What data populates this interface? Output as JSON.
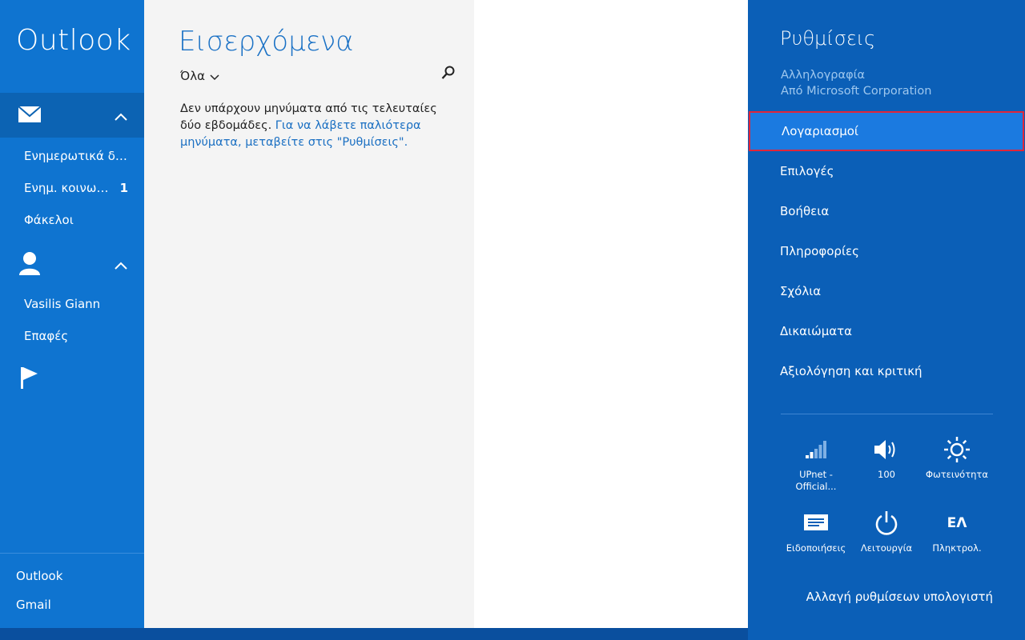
{
  "nav": {
    "app_title": "Outlook",
    "mail_items": [
      {
        "label": "Ενημερωτικά δελ...",
        "count": ""
      },
      {
        "label": "Ενημ. κοινων...",
        "count": "1"
      },
      {
        "label": "Φάκελοι",
        "count": ""
      }
    ],
    "people_items": [
      "Vasilis Giann",
      "Επαφές"
    ],
    "accounts": [
      "Outlook",
      "Gmail"
    ]
  },
  "list": {
    "folder_title": "Εισερχόμενα",
    "filter_label": "Όλα",
    "empty_text": "Δεν υπάρχουν μηνύματα από τις τελευταίες δύο εβδομάδες.",
    "empty_link": "Για να λάβετε παλιότερα μηνύματα, μεταβείτε στις \"Ρυθμίσεις\"."
  },
  "charm": {
    "title": "Ρυθμίσεις",
    "app_name": "Αλληλογραφία",
    "publisher": "Από Microsoft Corporation",
    "menu": [
      "Λογαριασμοί",
      "Επιλογές",
      "Βοήθεια",
      "Πληροφορίες",
      "Σχόλια",
      "Δικαιώματα",
      "Αξιολόγηση και κριτική"
    ],
    "tiles": {
      "network": "UPnet - Official...",
      "volume": "100",
      "brightness": "Φωτεινότητα",
      "notifications": "Ειδοποιήσεις",
      "power": "Λειτουργία",
      "keyboard_glyph": "ΕΛ",
      "keyboard": "Πληκτρολ."
    },
    "pc_settings": "Αλλαγή ρυθμίσεων υπολογιστή"
  },
  "colors": {
    "nav_bg": "#0f74d0",
    "charm_bg": "#0b5fb7",
    "highlight": "#1b7ae0",
    "highlight_border": "#e0263a",
    "accent_text": "#1a71c5"
  }
}
